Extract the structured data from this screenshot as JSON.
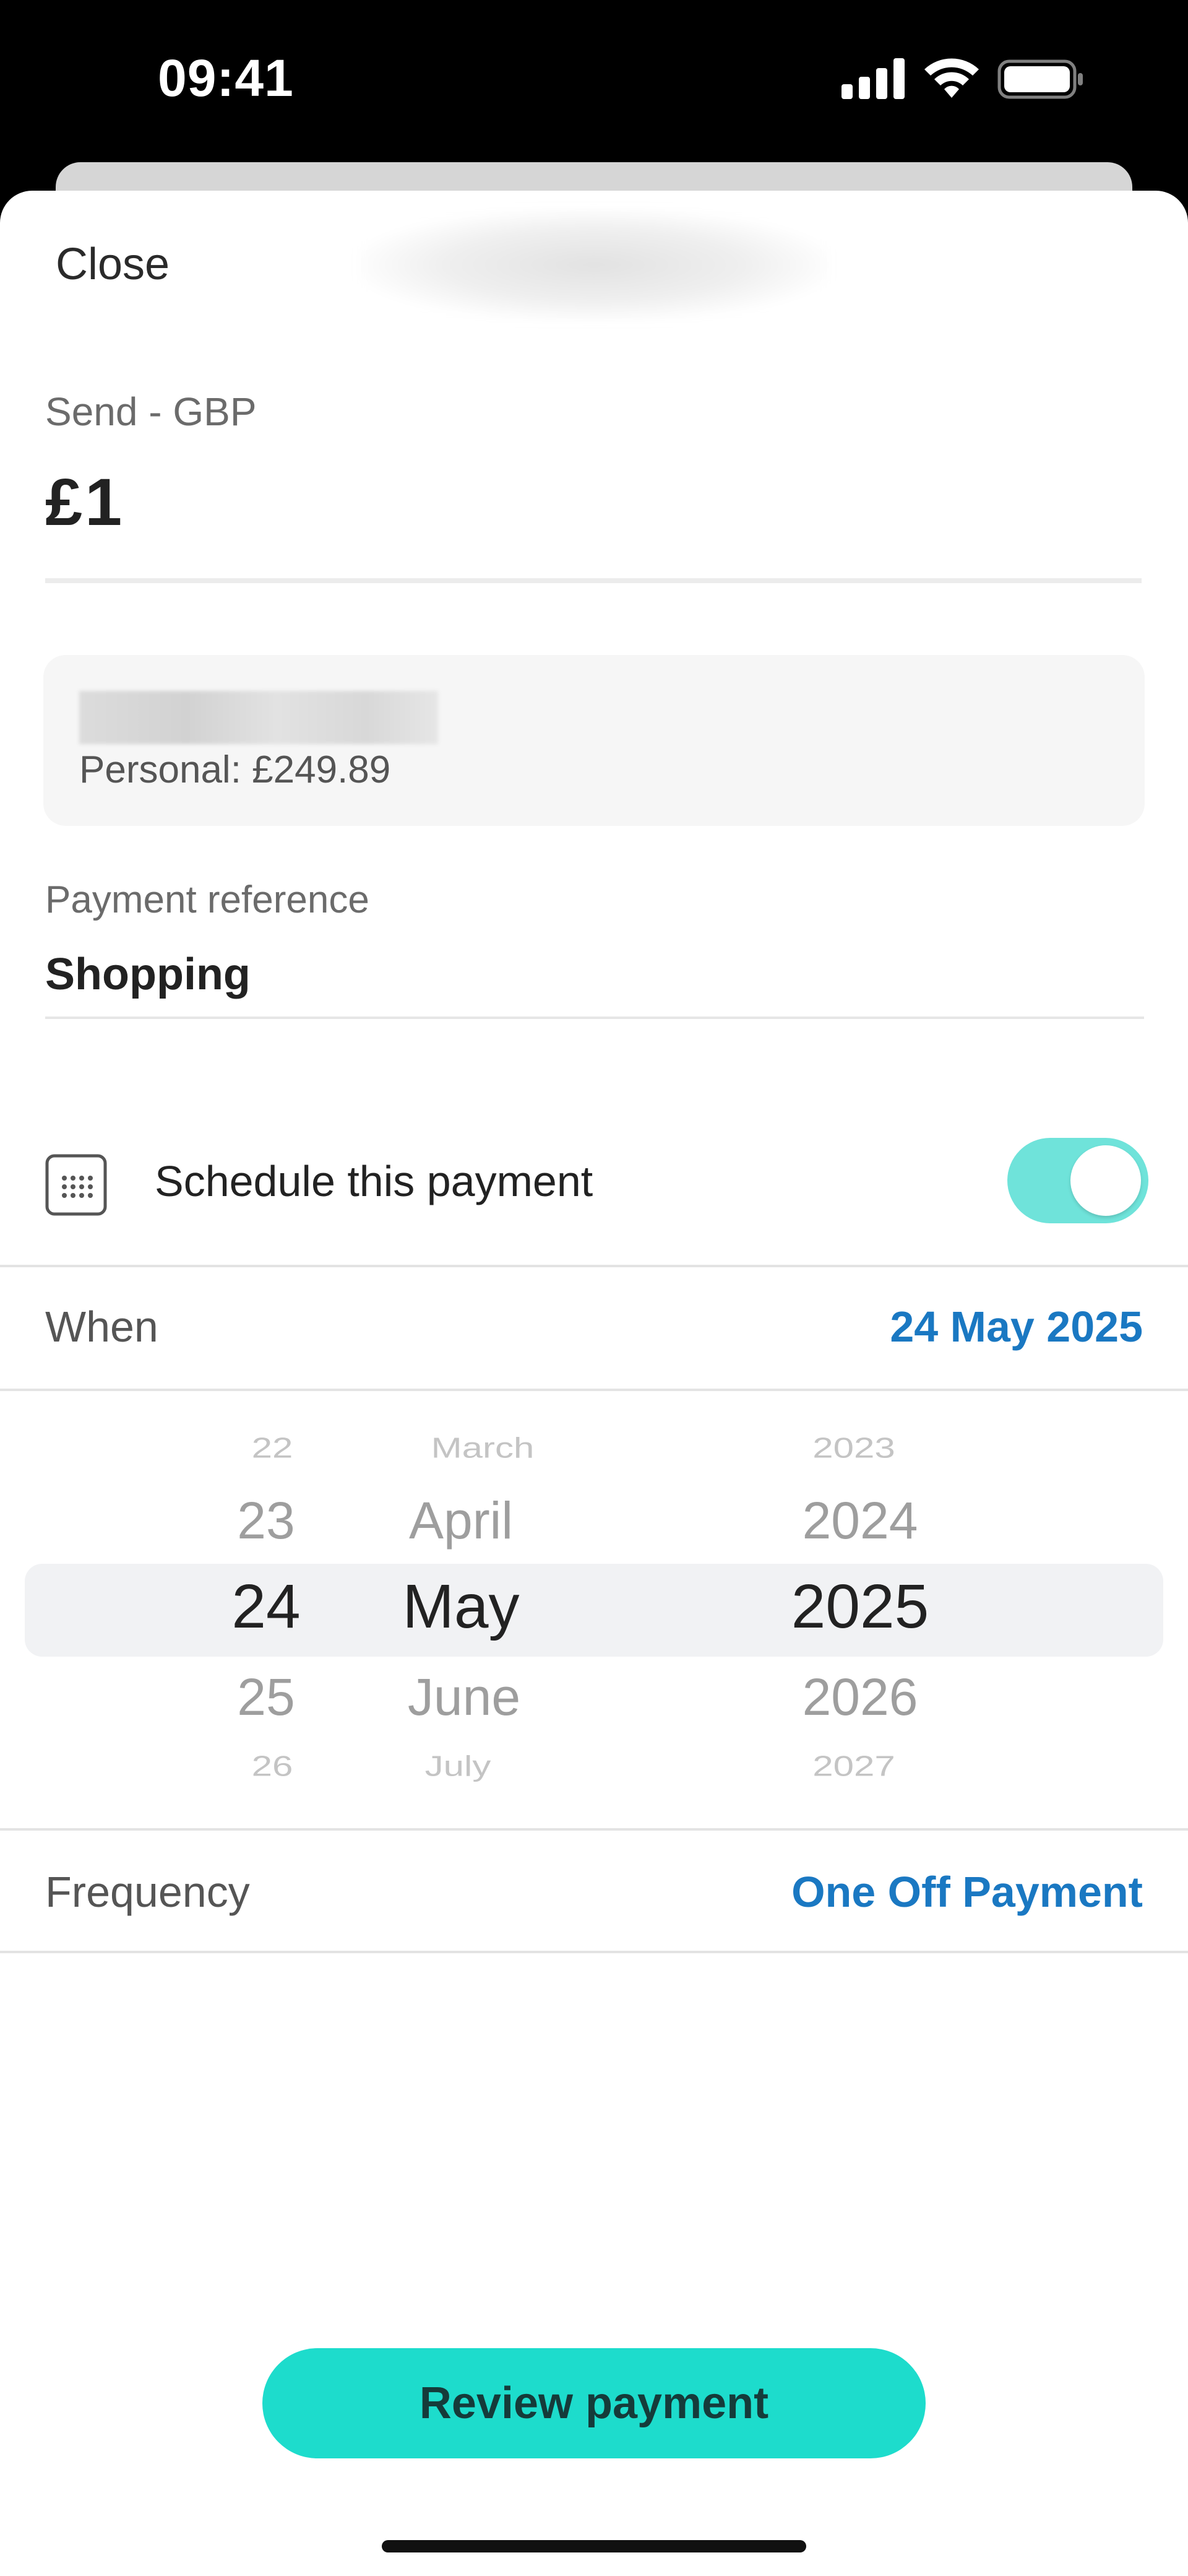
{
  "status_bar": {
    "time": "09:41"
  },
  "header": {
    "close_label": "Close"
  },
  "send": {
    "label": "Send - GBP",
    "amount": "£1"
  },
  "account": {
    "balance_text": "Personal: £249.89"
  },
  "reference": {
    "label": "Payment reference",
    "value": "Shopping"
  },
  "schedule": {
    "label": "Schedule this payment",
    "enabled": true,
    "icon": "calendar-icon"
  },
  "when": {
    "label": "When",
    "value": "24 May 2025"
  },
  "date_picker": {
    "days": [
      "22",
      "23",
      "24",
      "25",
      "26"
    ],
    "months": [
      "March",
      "April",
      "May",
      "June",
      "July"
    ],
    "years": [
      "2023",
      "2024",
      "2025",
      "2026",
      "2027"
    ],
    "selected": {
      "day": "24",
      "month": "May",
      "year": "2025"
    }
  },
  "frequency": {
    "label": "Frequency",
    "value": "One Off Payment"
  },
  "actions": {
    "review_label": "Review payment"
  },
  "colors": {
    "accent_link": "#1a78c2",
    "primary_button": "#1ddccc",
    "toggle_on": "#6fe3da"
  }
}
